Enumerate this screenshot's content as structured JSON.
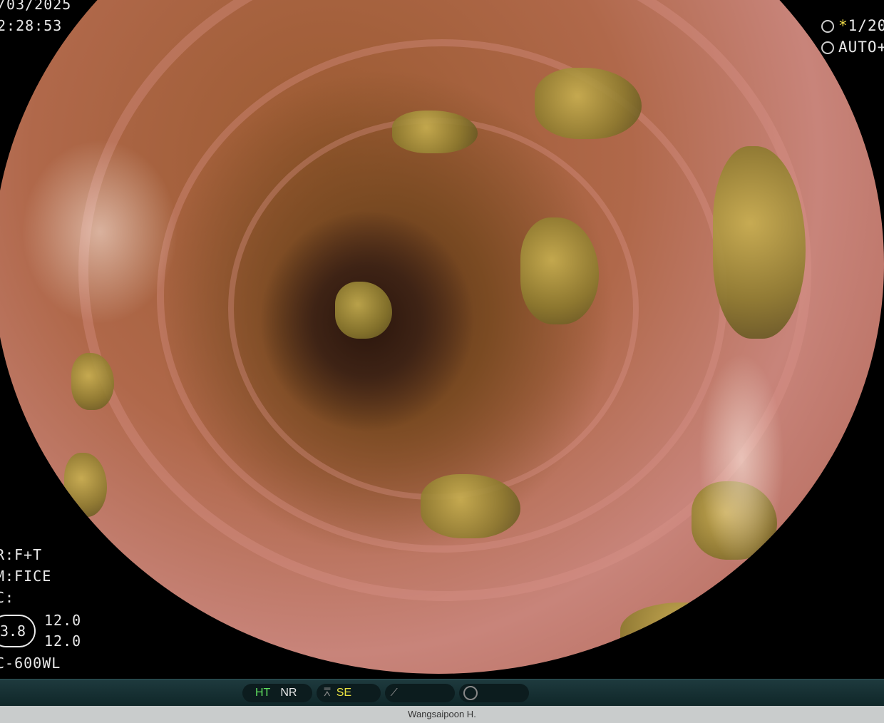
{
  "overlay": {
    "date": "/03/2025",
    "time": "2:28:53",
    "shutter": "1/20",
    "iris": "AUTO+",
    "mode_r": "R:F+T",
    "mode_m": "M:FICE",
    "mode_c": "C:",
    "oval_value": "3.8",
    "value_1": "12.0",
    "value_2": "12.0",
    "scope_model": "C-600WL"
  },
  "statusbar": {
    "ht": "HT",
    "nr": "NR",
    "se": "SE",
    "colors": {
      "ht": "#5fe05f",
      "se": "#e8e040",
      "nr": "#e8e8e8"
    }
  },
  "footer": {
    "operator": "Wangsaipoon H."
  }
}
